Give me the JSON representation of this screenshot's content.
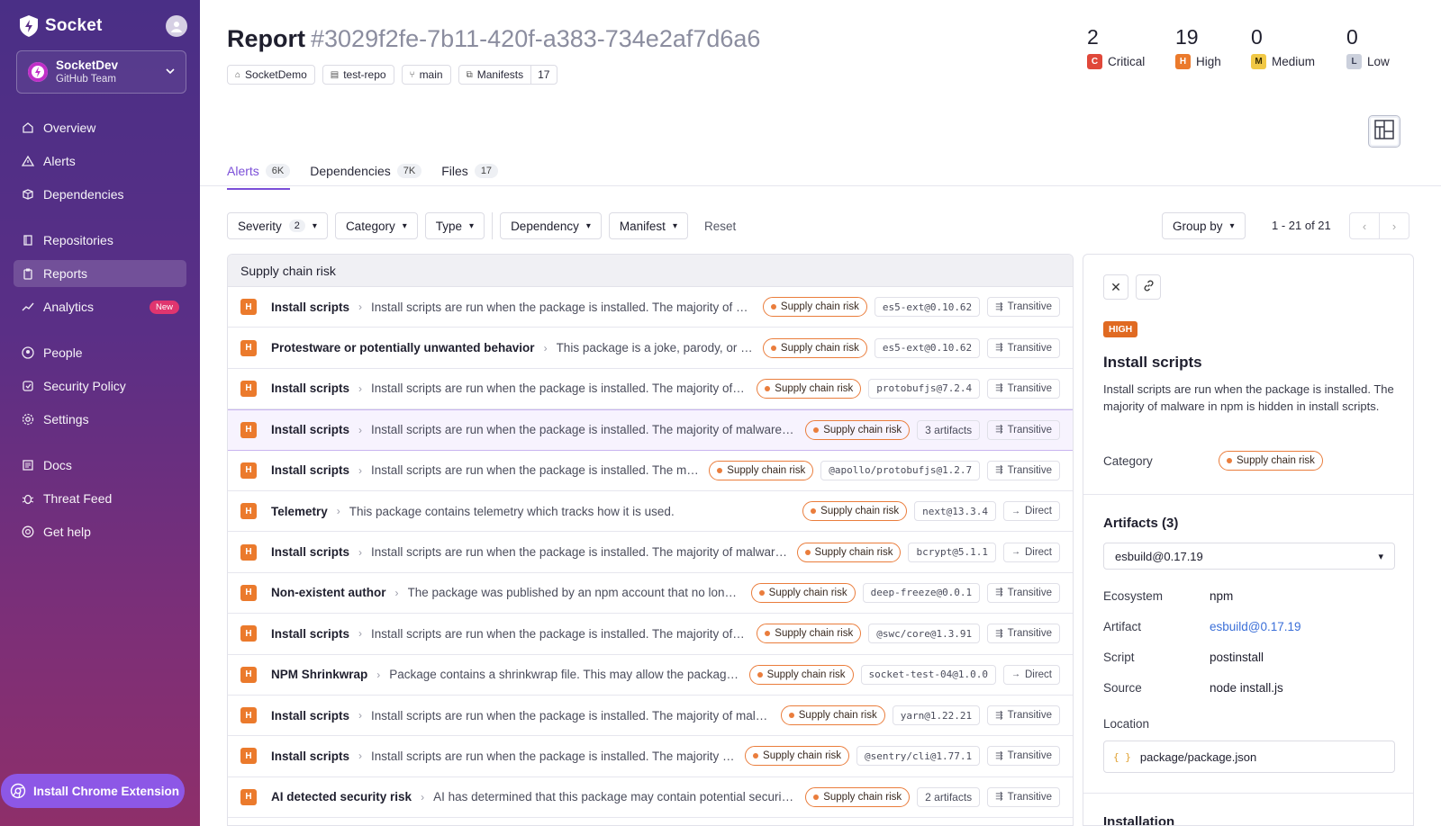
{
  "app": {
    "name": "Socket",
    "org_name": "SocketDev",
    "org_team": "GitHub Team",
    "nav": [
      {
        "label": "Overview",
        "icon": "home-icon"
      },
      {
        "label": "Alerts",
        "icon": "warning-icon"
      },
      {
        "label": "Dependencies",
        "icon": "package-icon"
      },
      {
        "label": "Repositories",
        "icon": "book-icon"
      },
      {
        "label": "Reports",
        "icon": "clipboard-icon",
        "active": true
      },
      {
        "label": "Analytics",
        "icon": "chart-icon",
        "badge": "New"
      },
      {
        "label": "People",
        "icon": "user-icon"
      },
      {
        "label": "Security Policy",
        "icon": "policy-icon"
      },
      {
        "label": "Settings",
        "icon": "gear-icon"
      },
      {
        "label": "Docs",
        "icon": "docs-icon"
      },
      {
        "label": "Threat Feed",
        "icon": "bug-icon"
      },
      {
        "label": "Get help",
        "icon": "help-icon"
      }
    ],
    "chrome_extension": "Install Chrome Extension"
  },
  "report": {
    "title": "Report",
    "id": "#3029f2fe-7b11-420f-a383-734e2af7d6a6",
    "chips": {
      "org": "SocketDemo",
      "repo": "test-repo",
      "branch": "main",
      "manifests_label": "Manifests",
      "manifests_count": "17"
    },
    "severity": {
      "critical": {
        "count": "2",
        "letter": "C",
        "label": "Critical"
      },
      "high": {
        "count": "19",
        "letter": "H",
        "label": "High"
      },
      "medium": {
        "count": "0",
        "letter": "M",
        "label": "Medium"
      },
      "low": {
        "count": "0",
        "letter": "L",
        "label": "Low"
      }
    }
  },
  "tabs": [
    {
      "label": "Alerts",
      "count": "6K"
    },
    {
      "label": "Dependencies",
      "count": "7K"
    },
    {
      "label": "Files",
      "count": "17"
    }
  ],
  "filters": {
    "severity": "Severity",
    "severity_count": "2",
    "category": "Category",
    "type": "Type",
    "dependency": "Dependency",
    "manifest": "Manifest",
    "reset": "Reset",
    "group_by": "Group by",
    "pagination": "1 - 21 of 21"
  },
  "table": {
    "group": "Supply chain risk",
    "rows": [
      {
        "sev": "H",
        "name": "Install scripts",
        "desc": "Install scripts are run when the package is installed. The majority of malware in npm is hidden in install scripts.",
        "risk": "Supply chain risk",
        "pkg": "es5-ext@0.10.62",
        "dep": "Transitive"
      },
      {
        "sev": "H",
        "name": "Protestware or potentially unwanted behavior",
        "desc": "This package is a joke, parody, or includes undocumented or hidden behavior.",
        "risk": "Supply chain risk",
        "pkg": "es5-ext@0.10.62",
        "dep": "Transitive"
      },
      {
        "sev": "H",
        "name": "Install scripts",
        "desc": "Install scripts are run when the package is installed. The majority of malware in npm is hidden in install scripts.",
        "risk": "Supply chain risk",
        "pkg": "protobufjs@7.2.4",
        "dep": "Transitive"
      },
      {
        "sev": "H",
        "name": "Install scripts",
        "desc": "Install scripts are run when the package is installed. The majority of malware in npm is hidden in install scripts.",
        "risk": "Supply chain risk",
        "pkg": "3 artifacts",
        "dep": "Transitive",
        "selected": true
      },
      {
        "sev": "H",
        "name": "Install scripts",
        "desc": "Install scripts are run when the package is installed. The majority of malware in npm is hidden in install scripts.",
        "risk": "Supply chain risk",
        "pkg": "@apollo/protobufjs@1.2.7",
        "dep": "Transitive"
      },
      {
        "sev": "H",
        "name": "Telemetry",
        "desc": "This package contains telemetry which tracks how it is used.",
        "risk": "Supply chain risk",
        "pkg": "next@13.3.4",
        "dep": "Direct"
      },
      {
        "sev": "H",
        "name": "Install scripts",
        "desc": "Install scripts are run when the package is installed. The majority of malware in npm is hidden in install scripts.",
        "risk": "Supply chain risk",
        "pkg": "bcrypt@5.1.1",
        "dep": "Direct"
      },
      {
        "sev": "H",
        "name": "Non-existent author",
        "desc": "The package was published by an npm account that no longer exists.",
        "risk": "Supply chain risk",
        "pkg": "deep-freeze@0.0.1",
        "dep": "Transitive"
      },
      {
        "sev": "H",
        "name": "Install scripts",
        "desc": "Install scripts are run when the package is installed. The majority of malware in npm is hidden in install scripts.",
        "risk": "Supply chain risk",
        "pkg": "@swc/core@1.3.91",
        "dep": "Transitive"
      },
      {
        "sev": "H",
        "name": "NPM Shrinkwrap",
        "desc": "Package contains a shrinkwrap file. This may allow the package to bypass normal install procedures.",
        "risk": "Supply chain risk",
        "pkg": "socket-test-04@1.0.0",
        "dep": "Direct"
      },
      {
        "sev": "H",
        "name": "Install scripts",
        "desc": "Install scripts are run when the package is installed. The majority of malware in npm is hidden in install scripts.",
        "risk": "Supply chain risk",
        "pkg": "yarn@1.22.21",
        "dep": "Transitive"
      },
      {
        "sev": "H",
        "name": "Install scripts",
        "desc": "Install scripts are run when the package is installed. The majority of malware in npm is hidden in install scripts.",
        "risk": "Supply chain risk",
        "pkg": "@sentry/cli@1.77.1",
        "dep": "Transitive"
      },
      {
        "sev": "H",
        "name": "AI detected security risk",
        "desc": "AI has determined that this package may contain potential security issues or vulnerabilities.",
        "risk": "Supply chain risk",
        "pkg": "2 artifacts",
        "dep": "Transitive"
      }
    ]
  },
  "detail": {
    "severity": "HIGH",
    "title": "Install scripts",
    "description": "Install scripts are run when the package is installed. The majority of malware in npm is hidden in install scripts.",
    "category_label": "Category",
    "category": "Supply chain risk",
    "artifacts_title": "Artifacts (3)",
    "artifact_selected": "esbuild@0.17.19",
    "ecosystem_label": "Ecosystem",
    "ecosystem": "npm",
    "artifact_label": "Artifact",
    "artifact": "esbuild@0.17.19",
    "script_label": "Script",
    "script": "postinstall",
    "source_label": "Source",
    "source": "node install.js",
    "location_label": "Location",
    "location": "package/package.json",
    "installation_title": "Installation"
  },
  "colors": {
    "accent": "#7b4fd8",
    "critical": "#e0483a",
    "high": "#eb7a2c",
    "medium": "#f1c845",
    "low": "#cbd0dc",
    "link": "#3b6fd8"
  }
}
